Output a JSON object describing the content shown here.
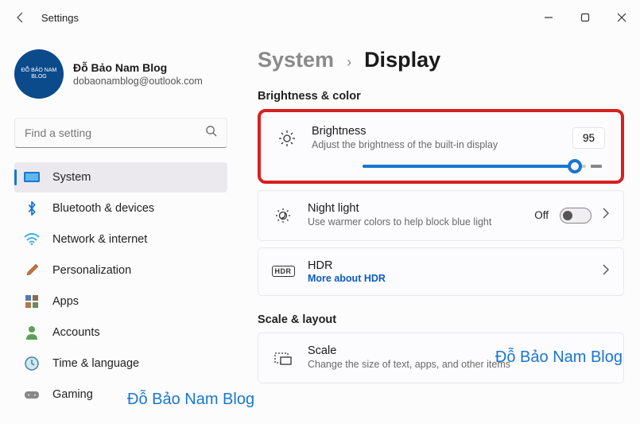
{
  "window": {
    "title": "Settings"
  },
  "profile": {
    "name": "Đỗ Bảo Nam Blog",
    "email": "dobaonamblog@outlook.com",
    "avatar_text": "ĐỖ BẢO NAM BLOG"
  },
  "search": {
    "placeholder": "Find a setting"
  },
  "nav": {
    "items": [
      {
        "label": "System",
        "icon": "system"
      },
      {
        "label": "Bluetooth & devices",
        "icon": "bluetooth"
      },
      {
        "label": "Network & internet",
        "icon": "wifi"
      },
      {
        "label": "Personalization",
        "icon": "brush"
      },
      {
        "label": "Apps",
        "icon": "apps"
      },
      {
        "label": "Accounts",
        "icon": "person"
      },
      {
        "label": "Time & language",
        "icon": "clock"
      },
      {
        "label": "Gaming",
        "icon": "gamepad"
      }
    ]
  },
  "breadcrumb": {
    "parent": "System",
    "current": "Display"
  },
  "sections": {
    "brightness_color": "Brightness & color",
    "scale_layout": "Scale & layout"
  },
  "brightness": {
    "title": "Brightness",
    "sub": "Adjust the brightness of the built-in display",
    "value": "95",
    "percent": 95
  },
  "nightlight": {
    "title": "Night light",
    "sub": "Use warmer colors to help block blue light",
    "state": "Off"
  },
  "hdr": {
    "title": "HDR",
    "link": "More about HDR",
    "badge": "HDR"
  },
  "scale": {
    "title": "Scale",
    "sub": "Change the size of text, apps, and other items"
  },
  "watermark": "Đỗ Bảo Nam Blog"
}
